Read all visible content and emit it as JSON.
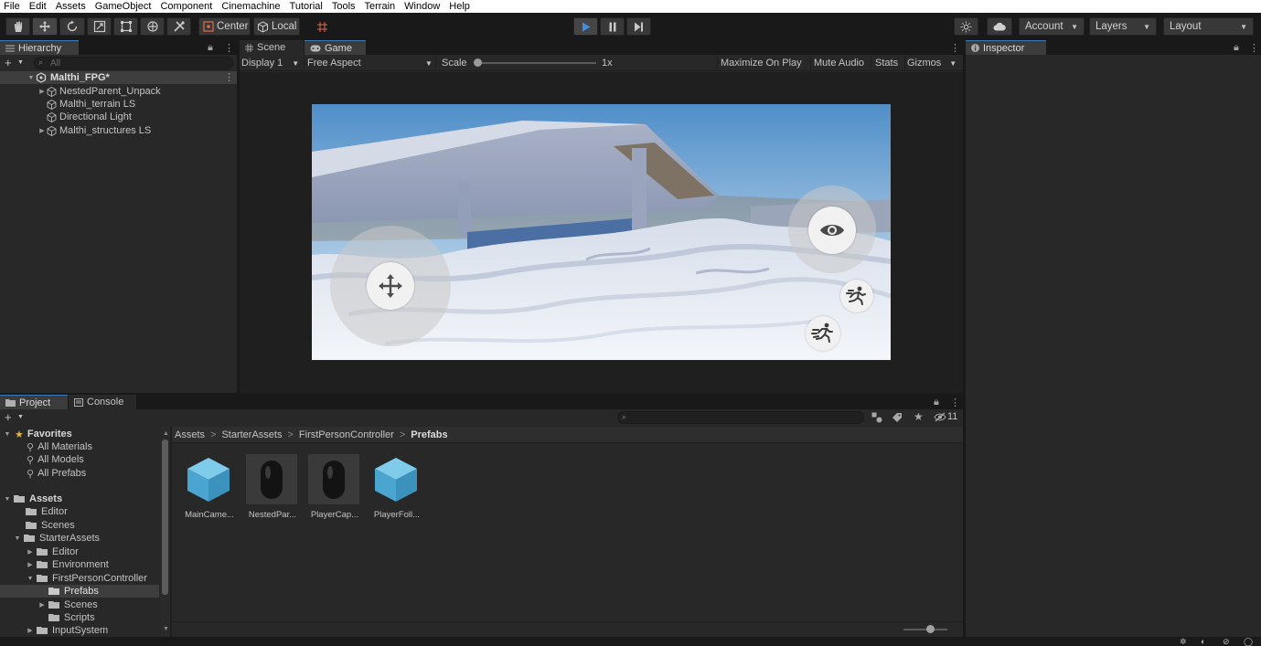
{
  "menu": [
    "File",
    "Edit",
    "Assets",
    "GameObject",
    "Component",
    "Cinemachine",
    "Tutorial",
    "Tools",
    "Terrain",
    "Window",
    "Help"
  ],
  "toolbar": {
    "pivot_label": "Center",
    "space_label": "Local",
    "account_label": "Account",
    "layers_label": "Layers",
    "layout_label": "Layout"
  },
  "hierarchy": {
    "tab": "Hierarchy",
    "search_placeholder": "All",
    "scene": "Malthi_FPG*",
    "items": [
      "NestedParent_Unpack",
      "Malthi_terrain LS",
      "Directional Light",
      "Malthi_structures LS"
    ]
  },
  "view": {
    "scene_tab": "Scene",
    "game_tab": "Game",
    "display": "Display 1",
    "aspect": "Free Aspect",
    "scale_label": "Scale",
    "scale_value": "1x",
    "maximize": "Maximize On Play",
    "mute": "Mute Audio",
    "stats": "Stats",
    "gizmos": "Gizmos"
  },
  "inspector": {
    "tab": "Inspector"
  },
  "project": {
    "project_tab": "Project",
    "console_tab": "Console",
    "hidden_count": "11",
    "breadcrumb": [
      "Assets",
      "StarterAssets",
      "FirstPersonController",
      "Prefabs"
    ],
    "favorites_label": "Favorites",
    "favorites": [
      "All Materials",
      "All Models",
      "All Prefabs"
    ],
    "assets_label": "Assets",
    "tree": {
      "editor": "Editor",
      "scenes": "Scenes",
      "starter": "StarterAssets",
      "starter_editor": "Editor",
      "environment": "Environment",
      "fpc": "FirstPersonController",
      "prefabs": "Prefabs",
      "fpc_scenes": "Scenes",
      "scripts": "Scripts",
      "inputsystem": "InputSystem"
    },
    "assets": [
      "MainCame...",
      "NestedPar...",
      "PlayerCap...",
      "PlayerFoll..."
    ]
  },
  "colors": {
    "accent": "#3a79bb",
    "selected_row": "#2c5d87",
    "cube": "#5bb6dc"
  }
}
